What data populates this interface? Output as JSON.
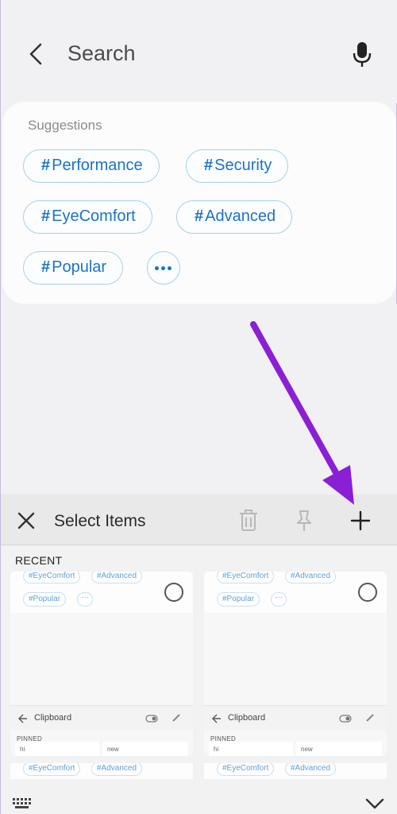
{
  "header": {
    "title": "Search"
  },
  "suggestions": {
    "label": "Suggestions",
    "chips": [
      {
        "hash": "#",
        "text": "Performance"
      },
      {
        "hash": "#",
        "text": "Security"
      },
      {
        "hash": "#",
        "text": "EyeComfort"
      },
      {
        "hash": "#",
        "text": "Advanced"
      },
      {
        "hash": "#",
        "text": "Popular"
      }
    ]
  },
  "clipboard_panel": {
    "title": "Select Items",
    "section_label": "RECENT",
    "thumbnails": [
      {
        "chips_top": [
          "#EyeComfort",
          "#Advanced"
        ],
        "chips_bottom": [
          "#Popular"
        ],
        "more": "···",
        "toolbar_title": "Clipboard",
        "pinned_label": "PINNED",
        "pinned_items": [
          "hi",
          "new"
        ]
      },
      {
        "chips_top": [
          "#EyeComfort",
          "#Advanced"
        ],
        "chips_bottom": [
          "#Popular"
        ],
        "more": "···",
        "toolbar_title": "Clipboard",
        "pinned_label": "PINNED",
        "pinned_items": [
          "hi",
          "new"
        ]
      }
    ],
    "thumbnails_row2": [
      {
        "chips_top": [
          "#EyeComfort",
          "#Advanced"
        ]
      },
      {
        "chips_top": [
          "#EyeComfort",
          "#Advanced"
        ]
      }
    ]
  },
  "colors": {
    "accent": "#1a73c8",
    "chip_border": "#a8d0ea",
    "annotation_arrow": "#8a1fd6"
  },
  "icons": [
    "back-arrow-icon",
    "microphone-icon",
    "close-icon",
    "trash-icon",
    "pin-icon",
    "plus-icon",
    "keyboard-icon",
    "chevron-down-icon"
  ]
}
